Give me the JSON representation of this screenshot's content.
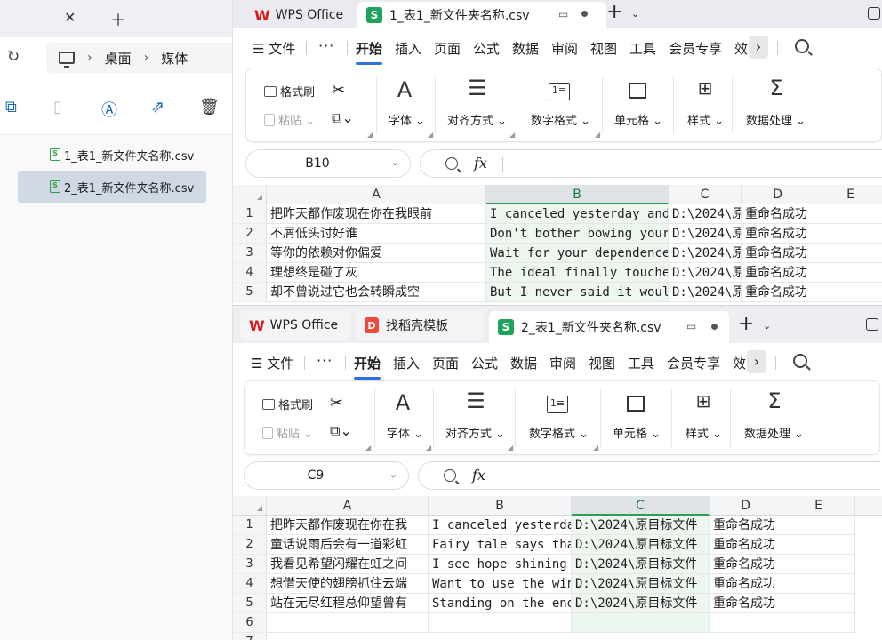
{
  "explorer": {
    "breadcrumb": [
      "桌面",
      "媒体"
    ],
    "files": [
      {
        "name": "1_表1_新文件夹名称.csv",
        "selected": false
      },
      {
        "name": "2_表1_新文件夹名称.csv",
        "selected": true
      }
    ],
    "icons": [
      "close-icon",
      "plus-icon",
      "refresh-icon",
      "monitor-icon",
      "copy-icon",
      "paste-icon",
      "rename-icon",
      "share-icon",
      "delete-icon"
    ]
  },
  "windows": [
    {
      "tabs": {
        "home": "WPS Office",
        "doc": "1_表1_新文件夹名称.csv"
      },
      "name_box": "B10",
      "selected_col": "B",
      "rows": [
        {
          "row": "1",
          "a": "把昨天都作废现在你在我眼前",
          "b": "I canceled yesterday and",
          "c": "D:\\2024\\原",
          "d": "重命名成功"
        },
        {
          "row": "2",
          "a": "不屑低头讨好谁",
          "b": "Don't bother bowing your",
          "c": "D:\\2024\\原",
          "d": "重命名成功"
        },
        {
          "row": "3",
          "a": "等你的依赖对你偏爱",
          "b": "Wait for your dependence",
          "c": "D:\\2024\\原",
          "d": "重命名成功"
        },
        {
          "row": "4",
          "a": "理想终是碰了灰",
          "b": "The ideal finally touches",
          "c": "D:\\2024\\原",
          "d": "重命名成功"
        },
        {
          "row": "5",
          "a": "却不曾说过它也会转瞬成空",
          "b": "But I never said it would",
          "c": "D:\\2024\\原",
          "d": "重命名成功"
        }
      ]
    },
    {
      "tabs": {
        "home": "WPS Office",
        "template": "找稻壳模板",
        "doc": "2_表1_新文件夹名称.csv"
      },
      "name_box": "C9",
      "selected_col": "C",
      "rows": [
        {
          "row": "1",
          "a": "把昨天都作废现在你在我",
          "b": "I canceled yesterda",
          "c": "D:\\2024\\原目标文件",
          "d": "重命名成功"
        },
        {
          "row": "2",
          "a": "童话说雨后会有一道彩虹",
          "b": "Fairy tale says tha",
          "c": "D:\\2024\\原目标文件",
          "d": "重命名成功"
        },
        {
          "row": "3",
          "a": "我看见希望闪耀在虹之间",
          "b": "I see hope shining",
          "c": "D:\\2024\\原目标文件",
          "d": "重命名成功"
        },
        {
          "row": "4",
          "a": "想借天使的翅膀抓住云端",
          "b": "Want to use the win",
          "c": "D:\\2024\\原目标文件",
          "d": "重命名成功"
        },
        {
          "row": "5",
          "a": "站在无尽红程总仰望曾有",
          "b": "Standing on the end",
          "c": "D:\\2024\\原目标文件",
          "d": "重命名成功"
        },
        {
          "row": "6",
          "a": "",
          "b": "",
          "c": "",
          "d": ""
        },
        {
          "row": "7",
          "a": "",
          "b": "",
          "c": "",
          "d": ""
        }
      ]
    }
  ],
  "menu": [
    "文件",
    "开始",
    "插入",
    "页面",
    "公式",
    "数据",
    "审阅",
    "视图",
    "工具",
    "会员专享",
    "效"
  ],
  "ribbon": {
    "format_painter": "格式刷",
    "paste": "粘贴",
    "font": "字体",
    "align": "对齐方式",
    "number_format": "数字格式",
    "cell": "单元格",
    "style": "样式",
    "data_process": "数据处理"
  },
  "columns": [
    "A",
    "B",
    "C",
    "D",
    "E"
  ],
  "fx_label": "fx",
  "colors": {
    "accent": "#2f6fe4",
    "selected_col": "#2f9d58",
    "wps_red": "#d81b1b",
    "csv_green": "#1ea45a"
  }
}
